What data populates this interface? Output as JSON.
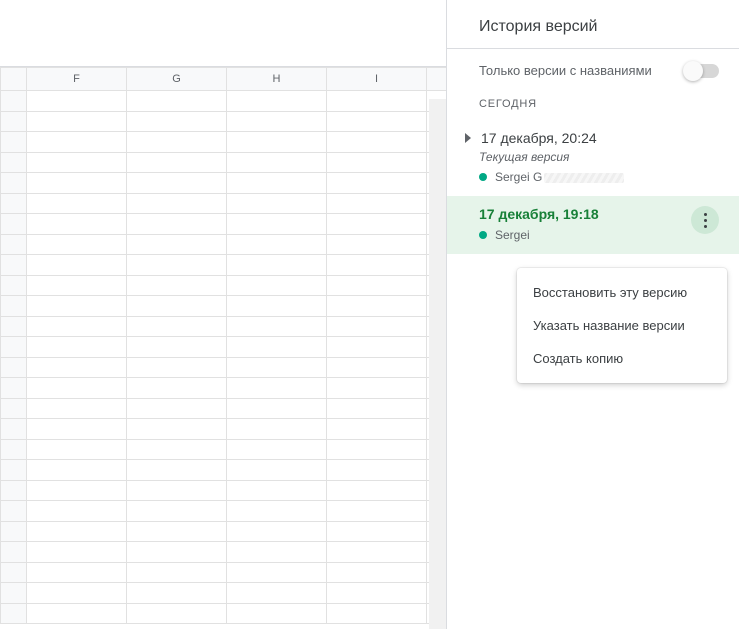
{
  "sheet": {
    "visible_columns": [
      "F",
      "G",
      "H",
      "I"
    ]
  },
  "panel": {
    "title": "История версий",
    "filter_label": "Только версии с названиями",
    "filter_on": false,
    "section_today": "СЕГОДНЯ",
    "versions": [
      {
        "timestamp": "17 декабря, 20:24",
        "subtitle": "Текущая версия",
        "author": "Sergei G",
        "author_dot_color": "#00a884",
        "expandable": true,
        "selected": false
      },
      {
        "timestamp": "17 декабря, 19:18",
        "subtitle": "",
        "author": "Sergei",
        "author_dot_color": "#00a884",
        "expandable": false,
        "selected": true
      }
    ]
  },
  "context_menu": {
    "items": [
      "Восстановить эту версию",
      "Указать название версии",
      "Создать копию"
    ]
  }
}
